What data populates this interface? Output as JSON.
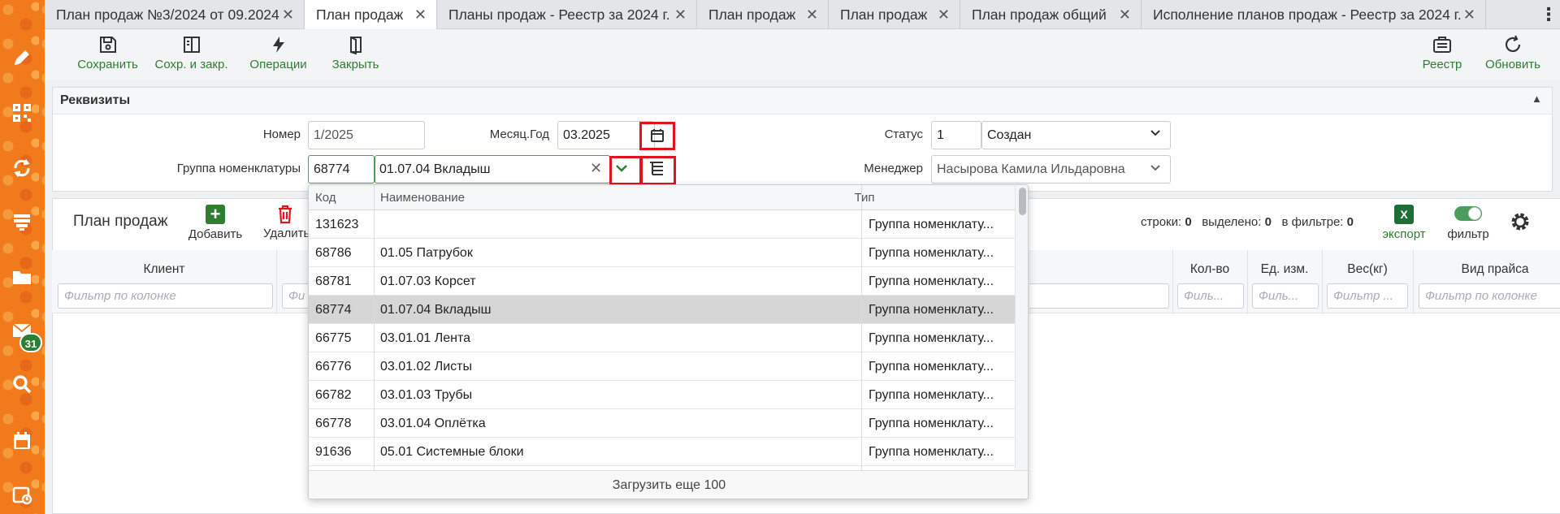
{
  "sidebar": {
    "badge_count": "31"
  },
  "tabs": [
    {
      "label": "План продаж №3/2024 от 09.2024",
      "active": false
    },
    {
      "label": "План продаж",
      "active": true
    },
    {
      "label": "Планы продаж - Реестр за 2024 г.",
      "active": false
    },
    {
      "label": "План продаж",
      "active": false
    },
    {
      "label": "План продаж",
      "active": false
    },
    {
      "label": "План продаж общий",
      "active": false
    },
    {
      "label": "Исполнение планов продаж - Реестр за 2024 г.",
      "active": false
    }
  ],
  "toolbar": {
    "save_label": "Сохранить",
    "save_close_label": "Сохр. и закр.",
    "operations_label": "Операции",
    "close_label": "Закрыть",
    "registry_label": "Реестр",
    "refresh_label": "Обновить"
  },
  "requisites": {
    "title": "Реквизиты",
    "number_label": "Номер",
    "number_value": "1/2025",
    "month_year_label": "Месяц.Год",
    "month_year_value": "03.2025",
    "status_label": "Статус",
    "status_code": "1",
    "status_value": "Создан",
    "group_label": "Группа номенклатуры",
    "group_code": "68774",
    "group_value": "01.07.04 Вкладыш",
    "manager_label": "Менеджер",
    "manager_value": "Насырова Камила Ильдаровна"
  },
  "plan": {
    "title": "План продаж",
    "add_label": "Добавить",
    "delete_label": "Удалить",
    "rows_label": "строки:",
    "rows_count": "0",
    "selected_label": "выделено:",
    "selected_count": "0",
    "in_filter_label": "в фильтре:",
    "in_filter_count": "0",
    "export_label": "экспорт",
    "filter_label": "фильтр",
    "columns": {
      "client": "Клиент",
      "qty": "Кол-во",
      "unit": "Ед. изм.",
      "weight": "Вес(кг)",
      "price_type": "Вид прайса"
    },
    "filter_placeholder": "Фильтр по колонке",
    "filter_short": "Филь...",
    "filter_weight": "Фильтр ...",
    "filter_partial": "Фи"
  },
  "dropdown": {
    "headers": {
      "code": "Код",
      "name": "Наименование",
      "type": "Тип"
    },
    "rows": [
      {
        "code": "131623",
        "name": "",
        "type": "Группа номенклату...",
        "selected": false
      },
      {
        "code": "68786",
        "name": "01.05 Патрубок",
        "type": "Группа номенклату...",
        "selected": false
      },
      {
        "code": "68781",
        "name": "01.07.03 Корсет",
        "type": "Группа номенклату...",
        "selected": false
      },
      {
        "code": "68774",
        "name": "01.07.04 Вкладыш",
        "type": "Группа номенклату...",
        "selected": true
      },
      {
        "code": "66775",
        "name": "03.01.01 Лента",
        "type": "Группа номенклату...",
        "selected": false
      },
      {
        "code": "66776",
        "name": "03.01.02 Листы",
        "type": "Группа номенклату...",
        "selected": false
      },
      {
        "code": "66782",
        "name": "03.01.03 Трубы",
        "type": "Группа номенклату...",
        "selected": false
      },
      {
        "code": "66778",
        "name": "03.01.04 Оплётка",
        "type": "Группа номенклату...",
        "selected": false
      },
      {
        "code": "91636",
        "name": "05.01 Системные блоки",
        "type": "Группа номенклату...",
        "selected": false
      }
    ],
    "load_more": "Загрузить еще 100"
  }
}
